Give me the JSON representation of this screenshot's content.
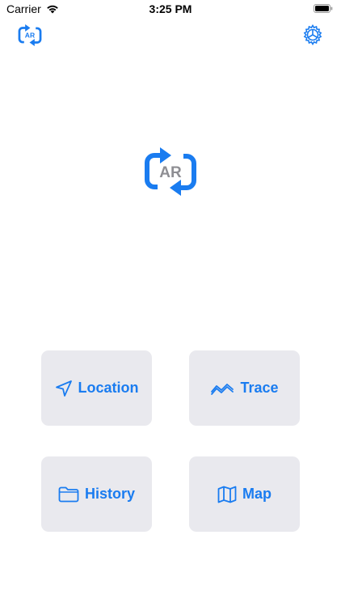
{
  "status_bar": {
    "carrier": "Carrier",
    "time": "3:25 PM"
  },
  "header": {
    "left_icon": "ar-sync-icon",
    "right_icon": "gear-icon"
  },
  "logo": {
    "text": "AR",
    "icon": "ar-sync-icon"
  },
  "buttons": [
    {
      "label": "Location",
      "icon": "location-arrow-icon"
    },
    {
      "label": "Trace",
      "icon": "trace-line-icon"
    },
    {
      "label": "History",
      "icon": "folder-icon"
    },
    {
      "label": "Map",
      "icon": "map-icon"
    }
  ],
  "colors": {
    "accent": "#1a7cf0",
    "button_bg": "#e9e9ee",
    "logo_text": "#8e8e93"
  }
}
